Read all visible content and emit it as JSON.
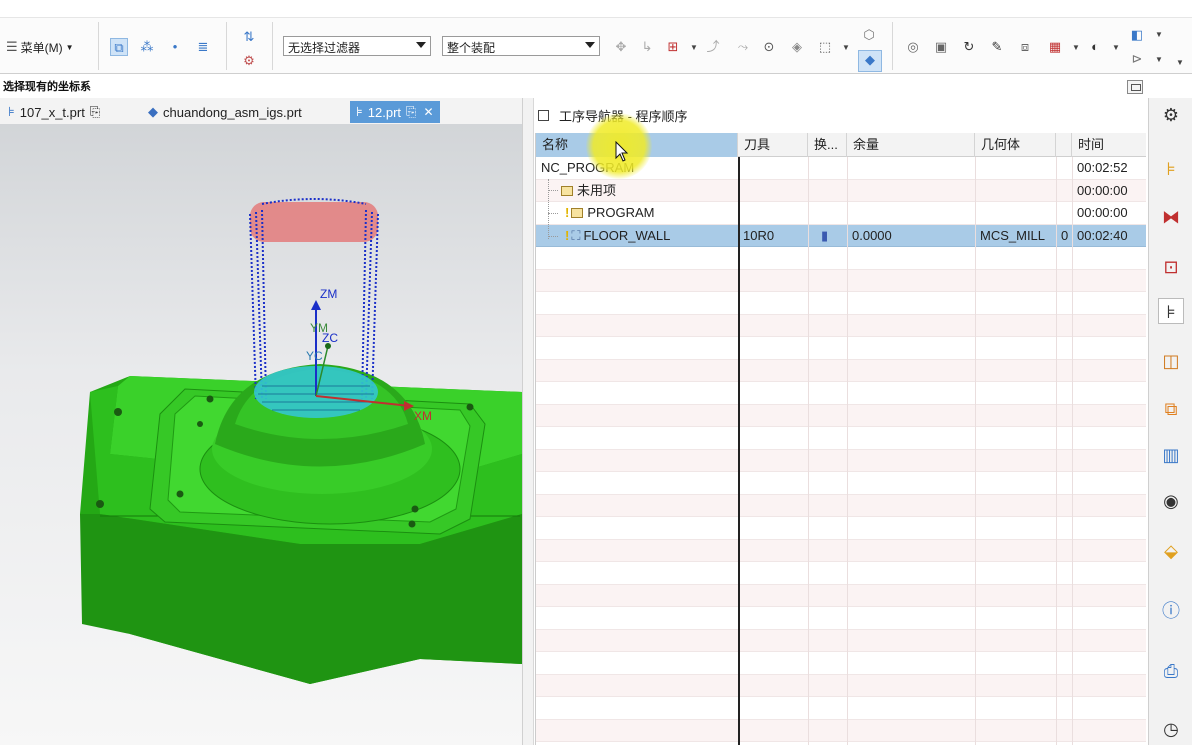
{
  "toolbar": {
    "menu_label": "菜单(M)",
    "filter_combo": "无选择过滤器",
    "assembly_combo": "整个装配",
    "colors": {
      "accent": "#3a78c8",
      "selected": "#cfe3f7"
    },
    "icons": [
      "select-icon",
      "snap-icon",
      "point-icon",
      "layout-icon",
      "wcs-icon",
      "filter-icon",
      "orient-icon",
      "csys-icon",
      "plane-icon",
      "circle-icon",
      "box-icon",
      "rect-select-icon",
      "cube-icon",
      "view-icon",
      "fit-icon",
      "rotate-icon",
      "pen-icon",
      "layer-icon",
      "grid-icon",
      "paint-icon",
      "cube-blue-icon",
      "view-dd-icon"
    ]
  },
  "status": {
    "prompt": "选择现有的坐标系"
  },
  "file_tabs": [
    {
      "label": "107_x_t.prt",
      "active": false
    },
    {
      "label": "chuandong_asm_igs.prt",
      "active": false
    },
    {
      "label": "12.prt",
      "active": true
    }
  ],
  "viewport": {
    "axis_labels": {
      "zm": "ZM",
      "ym": "YM",
      "zc": "ZC",
      "yc": "YC",
      "xm": "XM"
    },
    "colors": {
      "part": "#2fbf1f",
      "toolpath": "#1a2fc8",
      "top": "#e04a4a",
      "floor": "#30c8d8"
    }
  },
  "navigator": {
    "title": "工序导航器 - 程序顺序",
    "columns": [
      "名称",
      "刀具",
      "换...",
      "余量",
      "几何体",
      "",
      "时间"
    ],
    "rows": [
      {
        "name": "NC_PROGRAM",
        "tool": "",
        "change": "",
        "stock": "",
        "geometry": "",
        "extra": "",
        "time": "00:02:52",
        "level": 0
      },
      {
        "name": "未用项",
        "tool": "",
        "change": "",
        "stock": "",
        "geometry": "",
        "extra": "",
        "time": "00:00:00",
        "level": 1
      },
      {
        "name": "PROGRAM",
        "tool": "",
        "change": "",
        "stock": "",
        "geometry": "",
        "extra": "",
        "time": "00:00:00",
        "level": 1
      },
      {
        "name": "FLOOR_WALL",
        "tool": "10R0",
        "change": "",
        "stock": "0.0000",
        "geometry": "MCS_MILL",
        "extra": "0",
        "time": "00:02:40",
        "level": 2,
        "selected": true
      }
    ]
  },
  "resource_bar": {
    "icons": [
      "settings-icon",
      "assembly-nav-icon",
      "constraint-nav-icon",
      "part-nav-icon",
      "operation-nav-icon",
      "machine-tool-icon",
      "reuse-library-icon",
      "role-icon",
      "history-icon",
      "visual-icon",
      "web-icon",
      "info-icon",
      "doc-icon",
      "clock-icon"
    ]
  }
}
